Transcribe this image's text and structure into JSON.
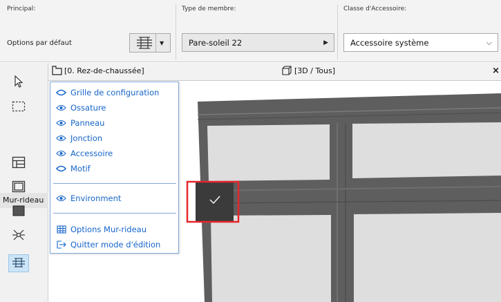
{
  "infobox": {
    "principal_label": "Principal:",
    "favorites_label": "Options par défaut",
    "member_type_label": "Type de membre:",
    "member_type_value": "Pare-soleil 22",
    "accessory_class_label": "Classe d'Accessoire:",
    "accessory_class_value": "Accessoire système"
  },
  "toolbox": {
    "section_label": "Mur-rideau",
    "tools": [
      "arrow-select",
      "marquee",
      "curtain-wall-frame",
      "curtain-wall-panel",
      "curtain-wall-junction",
      "curtain-wall-accessory",
      "curtain-wall-active"
    ]
  },
  "tabs": [
    {
      "label": "[0. Rez-de-chaussée]",
      "icon": "floorplan-icon"
    },
    {
      "label": "[3D / Tous]",
      "icon": "cube-3d-icon"
    }
  ],
  "tab_close": "×",
  "menu": {
    "items": [
      {
        "label": "Grille de configuration",
        "icon": "eye-closed-icon"
      },
      {
        "label": "Ossature",
        "icon": "eye-icon"
      },
      {
        "label": "Panneau",
        "icon": "eye-icon"
      },
      {
        "label": "Jonction",
        "icon": "eye-icon"
      },
      {
        "label": "Accessoire",
        "icon": "eye-icon"
      },
      {
        "label": "Motif",
        "icon": "eye-closed-icon"
      },
      {
        "label": "Environment",
        "icon": "eye-icon"
      },
      {
        "label": "Options Mur-rideau",
        "icon": "curtain-wall-settings-icon"
      },
      {
        "label": "Quitter mode d'édition",
        "icon": "exit-icon"
      }
    ]
  },
  "colors": {
    "menu_text": "#1665c9",
    "menu_border": "#7fa6d8",
    "selection_highlight": "#e8262c",
    "active_tool_bg": "#cce4f7",
    "frame_dark": "#5e5e5e",
    "panel_light": "#dedede"
  }
}
